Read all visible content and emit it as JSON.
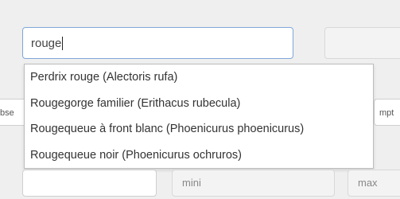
{
  "search": {
    "value": "rouge"
  },
  "autocomplete": {
    "options": [
      "Perdrix rouge (Alectoris rufa)",
      "Rougegorge familier (Erithacus rubecula)",
      "Rougequeue à front blanc (Phoenicurus phoenicurus)",
      "Rougequeue noir (Phoenicurus ochruros)"
    ]
  },
  "left_field": {
    "visible_text": "bse"
  },
  "right_field": {
    "visible_text": "mpt"
  },
  "min_field": {
    "placeholder": "mini"
  },
  "max_field": {
    "placeholder": "max"
  }
}
